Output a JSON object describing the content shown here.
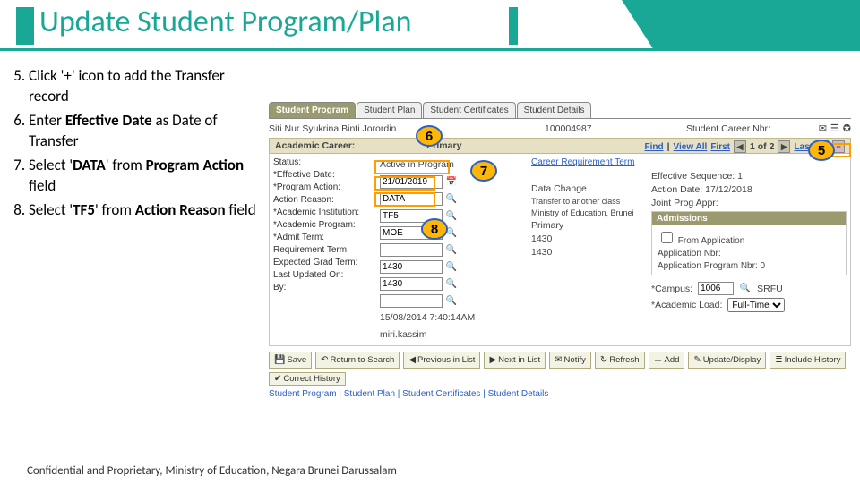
{
  "title": "Update Student Program/Plan",
  "footer": "Confidential and Proprietary, Ministry of Education, Negara Brunei Darussalam",
  "steps": [
    {
      "n": "5.",
      "html": "Click '+' icon to add the Transfer record"
    },
    {
      "n": "6.",
      "html": "Enter <b>Effective Date</b> as Date of Transfer"
    },
    {
      "n": "7.",
      "html": "Select '<b>DATA</b>' from <b>Program Action</b> field"
    },
    {
      "n": "8.",
      "html": "Select '<b>TF5</b>' from <b>Action Reason</b> field"
    }
  ],
  "tabs": [
    "Student Program",
    "Student Plan",
    "Student Certificates",
    "Student Details"
  ],
  "active_tab": 0,
  "student": {
    "name": "Siti Nur Syukrina Binti Jorordin",
    "id": "100004987",
    "career_lbl": "Student Career Nbr:",
    "career_nbr": "",
    "icons": [
      "✉",
      "☰",
      "✪"
    ]
  },
  "section_title": "Academic Career:",
  "section_val": "Primary",
  "nav": {
    "find": "Find",
    "viewall": "View All",
    "first": "First",
    "idx": "1 of 2",
    "last": "Last"
  },
  "status_lbl": "Status:",
  "status_val": "Active in Program",
  "labels": {
    "eff_date": "*Effective Date:",
    "prog_action": "*Program Action:",
    "action_reason": "Action Reason:",
    "acad_inst": "*Academic Institution:",
    "acad_prog": "*Academic Program:",
    "admit_term": "*Admit Term:",
    "req_term": "Requirement Term:",
    "exp_grad": "Expected Grad Term:",
    "last_upd": "Last Updated On:",
    "by": "By:"
  },
  "vals": {
    "eff_date": "21/01/2019",
    "prog_action": "DATA",
    "action_reason": "TF5",
    "acad_inst": "MOE",
    "acad_prog": "",
    "admit_term": "1430",
    "req_term": "1430",
    "exp_grad": "",
    "last_upd": "15/08/2014  7:40:14AM",
    "by": "miri.kassim"
  },
  "desc": {
    "prog_action": "Data Change",
    "action_reason": "Transfer to another class",
    "acad_inst": "Ministry of Education, Brunei",
    "acad_prog": "Primary",
    "admit_term": "1430",
    "req_term": "1430",
    "req_link": "Career Requirement Term",
    "eff_seq_lbl": "Effective Sequence:",
    "eff_seq": "1",
    "action_date_lbl": "Action Date:",
    "action_date": "17/12/2018",
    "joint_lbl": "Joint Prog Appr:"
  },
  "admissions": {
    "head": "Admissions",
    "from_app": "From Application",
    "app_nbr_lbl": "Application Nbr:",
    "app_nbr": "",
    "app_prog_lbl": "Application Program Nbr:",
    "app_prog": "0",
    "campus_lbl": "*Campus:",
    "campus": "1006",
    "srfu": "SRFU",
    "acad_load_lbl": "*Academic Load:",
    "acad_load": "Full-Time"
  },
  "buttons": [
    "Save",
    "Return to Search",
    "Previous in List",
    "Next in List",
    "Notify",
    "Refresh",
    "Add",
    "Update/Display",
    "Include History",
    "Correct History"
  ],
  "btn_icons": [
    "💾",
    "↶",
    "◀",
    "▶",
    "✉",
    "↻",
    "＋",
    "✎",
    "≣",
    "✔"
  ],
  "bottom_links": "Student Program | Student Plan | Student Certificates | Student Details",
  "callouts": {
    "5": "5",
    "6": "6",
    "7": "7",
    "8": "8"
  }
}
